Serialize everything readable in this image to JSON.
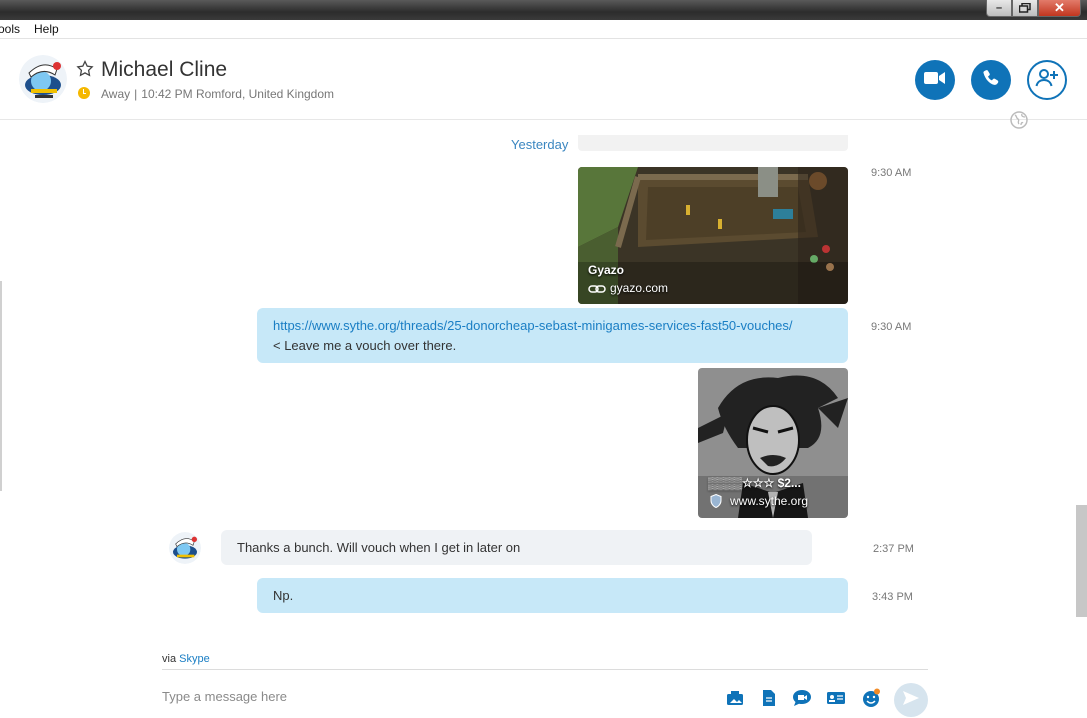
{
  "window": {
    "minimize_icon": "minimize-icon",
    "restore_icon": "restore-icon",
    "close_icon": "close-icon"
  },
  "menu": {
    "items": [
      "ools",
      "Help"
    ]
  },
  "contact": {
    "name": "Michael Cline",
    "status": "Away",
    "separator": "|",
    "local_time_location": "10:42 PM Romford, United Kingdom",
    "status_color": "#f5b800"
  },
  "header_actions": {
    "video_call_icon": "video-camera-icon",
    "audio_call_icon": "phone-icon",
    "add_people_icon": "add-person-icon"
  },
  "conversation": {
    "date_divider": "Yesterday",
    "messages": [
      {
        "type": "link-preview",
        "title": "Gyazo",
        "site": "gyazo.com",
        "time": "9:30 AM"
      },
      {
        "type": "text",
        "direction": "outgoing",
        "url": "https://www.sythe.org/threads/25-donorcheap-sebast-minigames-services-fast50-vouches/",
        "text": "< Leave me a vouch over there.",
        "time": "9:30 AM"
      },
      {
        "type": "link-preview",
        "title": "▒▒▒▒☆☆☆ $2...",
        "site": "www.sythe.org"
      },
      {
        "type": "text",
        "direction": "incoming",
        "text": "Thanks a bunch. Will vouch when I get in later on",
        "time": "2:37 PM"
      },
      {
        "type": "text",
        "direction": "outgoing",
        "text": "Np.",
        "time": "3:43 PM"
      }
    ],
    "via_label": "via",
    "via_service": "Skype"
  },
  "compose": {
    "placeholder": "Type a message here",
    "tools": [
      "image-icon",
      "file-icon",
      "video-message-icon",
      "contact-card-icon",
      "emoticon-icon"
    ],
    "send_icon": "send-icon"
  },
  "colors": {
    "accent": "#0f73b8",
    "outgoing_bubble": "#c7e8f8",
    "incoming_bubble": "#eff2f5",
    "link": "#1a7ec4"
  }
}
